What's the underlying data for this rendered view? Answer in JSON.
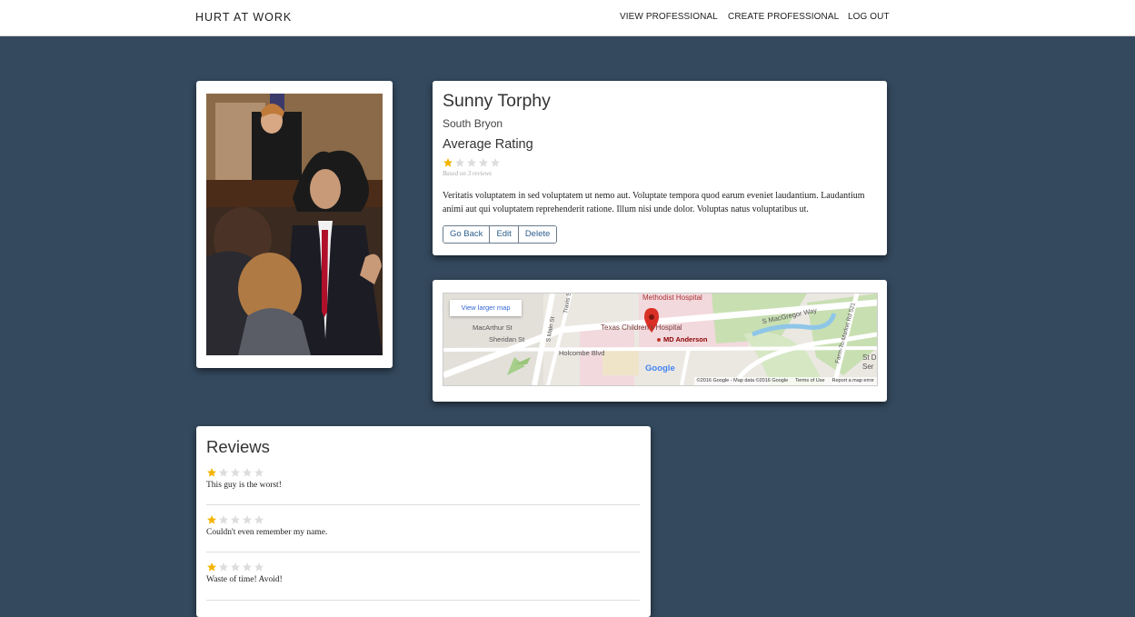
{
  "nav": {
    "brand": "HURT AT WORK",
    "links": [
      "VIEW PROFESSIONAL",
      "CREATE PROFESSIONAL",
      "LOG OUT"
    ]
  },
  "profile": {
    "name": "Sunny Torphy",
    "location": "South Bryon",
    "average_rating_label": "Average Rating",
    "rating": 1,
    "max_rating": 5,
    "based_on": "Based on 3 reviews",
    "description": "Veritatis voluptatem in sed voluptatem ut nemo aut. Voluptate tempora quod earum eveniet laudantium. Laudantium animi aut qui voluptatem reprehenderit ratione. Illum nisi unde dolor. Voluptas natus voluptatibus ut.",
    "buttons": {
      "back": "Go Back",
      "edit": "Edit",
      "delete": "Delete"
    }
  },
  "map": {
    "larger_map": "View larger map",
    "labels": {
      "methodist": "Methodist Hospital",
      "texas_childrens": "Texas Children's Hospital",
      "md_anderson": "MD Anderson",
      "macarthur": "MacArthur St",
      "sheridan": "Sheridan St",
      "holcombe": "Holcombe Blvd",
      "macgregor": "S MacGregor Way",
      "main": "S Main St",
      "travis": "Travis St",
      "fm521": "Farm-To-Market Rd 521",
      "st_d": "St D",
      "ser": "Ser"
    },
    "google": "Google",
    "footer": [
      "©2016 Google - Map data ©2016 Google",
      "Terms of Use",
      "Report a map error"
    ]
  },
  "reviews": {
    "title": "Reviews",
    "items": [
      {
        "rating": 1,
        "text": "This guy is the worst!"
      },
      {
        "rating": 1,
        "text": "Couldn't even remember my name."
      },
      {
        "rating": 1,
        "text": "Waste of time! Avoid!"
      }
    ]
  },
  "colors": {
    "background": "#34495e",
    "star_filled": "#f4b400",
    "star_empty": "#dddddd",
    "button_text": "#2c5d8a"
  }
}
